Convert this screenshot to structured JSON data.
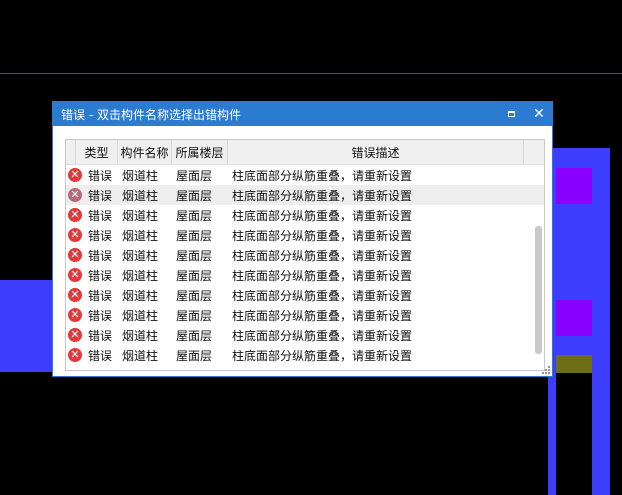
{
  "dialog": {
    "title": "错误 - 双击构件名称选择出错构件"
  },
  "table": {
    "headers": [
      "类型",
      "构件名称",
      "所属楼层",
      "错误描述"
    ],
    "rows": [
      {
        "type": "错误",
        "name": "烟道柱",
        "floor": "屋面层",
        "desc": "柱底面部分纵筋重叠，请重新设置"
      },
      {
        "type": "错误",
        "name": "烟道柱",
        "floor": "屋面层",
        "desc": "柱底面部分纵筋重叠，请重新设置"
      },
      {
        "type": "错误",
        "name": "烟道柱",
        "floor": "屋面层",
        "desc": "柱底面部分纵筋重叠，请重新设置"
      },
      {
        "type": "错误",
        "name": "烟道柱",
        "floor": "屋面层",
        "desc": "柱底面部分纵筋重叠，请重新设置"
      },
      {
        "type": "错误",
        "name": "烟道柱",
        "floor": "屋面层",
        "desc": "柱底面部分纵筋重叠，请重新设置"
      },
      {
        "type": "错误",
        "name": "烟道柱",
        "floor": "屋面层",
        "desc": "柱底面部分纵筋重叠，请重新设置"
      },
      {
        "type": "错误",
        "name": "烟道柱",
        "floor": "屋面层",
        "desc": "柱底面部分纵筋重叠，请重新设置"
      },
      {
        "type": "错误",
        "name": "烟道柱",
        "floor": "屋面层",
        "desc": "柱底面部分纵筋重叠，请重新设置"
      },
      {
        "type": "错误",
        "name": "烟道柱",
        "floor": "屋面层",
        "desc": "柱底面部分纵筋重叠，请重新设置"
      },
      {
        "type": "错误",
        "name": "烟道柱",
        "floor": "屋面层",
        "desc": "柱底面部分纵筋重叠，请重新设置"
      }
    ],
    "selected_row_index": 1
  },
  "colors": {
    "titlebar": "#2b7bd1",
    "error_icon": "#e23a3a",
    "background_blue": "#3d3dfd",
    "background_purple": "#8a00ff"
  },
  "icons": {
    "maximize": "maximize-icon",
    "close": "close-icon",
    "error": "error-icon",
    "resize": "resize-grip-icon"
  }
}
